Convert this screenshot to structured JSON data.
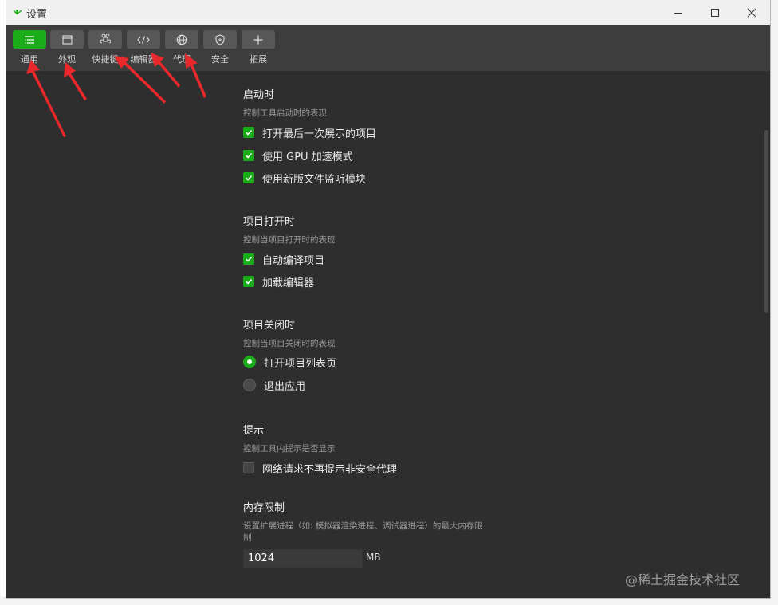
{
  "window": {
    "title": "设置"
  },
  "toolbar": {
    "items": [
      {
        "label": "通用",
        "icon": "list-icon",
        "active": true
      },
      {
        "label": "外观",
        "icon": "window-icon",
        "active": false
      },
      {
        "label": "快捷键",
        "icon": "command-icon",
        "active": false
      },
      {
        "label": "编辑器",
        "icon": "code-icon",
        "active": false
      },
      {
        "label": "代理",
        "icon": "globe-icon",
        "active": false
      },
      {
        "label": "安全",
        "icon": "shield-icon",
        "active": false
      },
      {
        "label": "拓展",
        "icon": "plus-icon",
        "active": false
      }
    ]
  },
  "sections": {
    "startup": {
      "title": "启动时",
      "desc": "控制工具启动时的表现",
      "options": [
        {
          "label": "打开最后一次展示的项目",
          "checked": true
        },
        {
          "label": "使用 GPU 加速模式",
          "checked": true
        },
        {
          "label": "使用新版文件监听模块",
          "checked": true
        }
      ]
    },
    "project_open": {
      "title": "项目打开时",
      "desc": "控制当项目打开时的表现",
      "options": [
        {
          "label": "自动编译项目",
          "checked": true
        },
        {
          "label": "加载编辑器",
          "checked": true
        }
      ]
    },
    "project_close": {
      "title": "项目关闭时",
      "desc": "控制当项目关闭时的表现",
      "options": [
        {
          "label": "打开项目列表页",
          "selected": true
        },
        {
          "label": "退出应用",
          "selected": false
        }
      ]
    },
    "hints": {
      "title": "提示",
      "desc": "控制工具内提示是否显示",
      "options": [
        {
          "label": "网络请求不再提示非安全代理",
          "checked": false
        }
      ]
    },
    "memory": {
      "title": "内存限制",
      "desc_line1": "设置扩展进程（如: 模拟器渲染进程、调试器进程）的最大内存限",
      "desc_line2": "制",
      "value": "1024",
      "unit": "MB"
    }
  },
  "watermark": "@稀土掘金技术社区",
  "colors": {
    "accent": "#1aad19",
    "background": "#2e2e2e",
    "toolbar": "#3d3d3d",
    "annotation_arrow": "#e8282b"
  }
}
